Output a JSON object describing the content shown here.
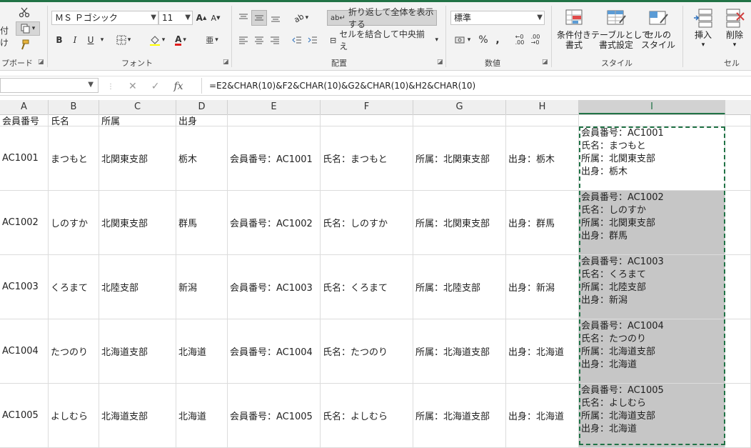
{
  "ribbon": {
    "clipboard": {
      "paste_label": "付け",
      "group_label": "プボード"
    },
    "font": {
      "name": "ＭＳ Ｐゴシック",
      "size": "11",
      "group_label": "フォント",
      "bold": "B",
      "italic": "I",
      "underline": "U"
    },
    "alignment": {
      "wrap_label": "折り返して全体を表示する",
      "merge_label": "セルを結合して中央揃え",
      "group_label": "配置"
    },
    "number": {
      "format": "標準",
      "percent": "%",
      "comma": ",",
      "group_label": "数値"
    },
    "styles": {
      "conditional_label": "条件付き\n書式",
      "table_label": "テーブルとして\n書式設定",
      "cell_styles_label": "セルの\nスタイル",
      "group_label": "スタイル"
    },
    "cells": {
      "insert_label": "挿入",
      "delete_label": "削除",
      "group_label": "セル"
    }
  },
  "formula_bar": {
    "name_box": "",
    "formula": "=E2&CHAR(10)&F2&CHAR(10)&G2&CHAR(10)&H2&CHAR(10)",
    "fx_label": "fx"
  },
  "columns": [
    "A",
    "B",
    "C",
    "D",
    "E",
    "F",
    "G",
    "H",
    "I"
  ],
  "header_row": [
    "会員番号",
    "氏名",
    "所属",
    "出身",
    "",
    "",
    "",
    "",
    ""
  ],
  "rows": [
    {
      "a": "AC1001",
      "b": "まつもと",
      "c": "北関東支部",
      "d": "栃木",
      "e": "会員番号：AC1001",
      "f": "氏名：まつもと",
      "g": "所属：北関東支部",
      "h": "出身：栃木",
      "i": "会員番号：AC1001\n氏名：まつもと\n所属：北関東支部\n出身：栃木"
    },
    {
      "a": "AC1002",
      "b": "しのすか",
      "c": "北関東支部",
      "d": "群馬",
      "e": "会員番号：AC1002",
      "f": "氏名：しのすか",
      "g": "所属：北関東支部",
      "h": "出身：群馬",
      "i": "会員番号：AC1002\n氏名：しのすか\n所属：北関東支部\n出身：群馬"
    },
    {
      "a": "AC1003",
      "b": "くろまて",
      "c": "北陸支部",
      "d": "新潟",
      "e": "会員番号：AC1003",
      "f": "氏名：くろまて",
      "g": "所属：北陸支部",
      "h": "出身：新潟",
      "i": "会員番号：AC1003\n氏名：くろまて\n所属：北陸支部\n出身：新潟"
    },
    {
      "a": "AC1004",
      "b": "たつのり",
      "c": "北海道支部",
      "d": "北海道",
      "e": "会員番号：AC1004",
      "f": "氏名：たつのり",
      "g": "所属：北海道支部",
      "h": "出身：北海道",
      "i": "会員番号：AC1004\n氏名：たつのり\n所属：北海道支部\n出身：北海道"
    },
    {
      "a": "AC1005",
      "b": "よしむら",
      "c": "北海道支部",
      "d": "北海道",
      "e": "会員番号：AC1005",
      "f": "氏名：よしむら",
      "g": "所属：北海道支部",
      "h": "出身：北海道",
      "i": "会員番号：AC1005\n氏名：よしむら\n所属：北海道支部\n出身：北海道"
    }
  ],
  "colors": {
    "accent": "#217346",
    "selection": "#c6c6c6"
  }
}
